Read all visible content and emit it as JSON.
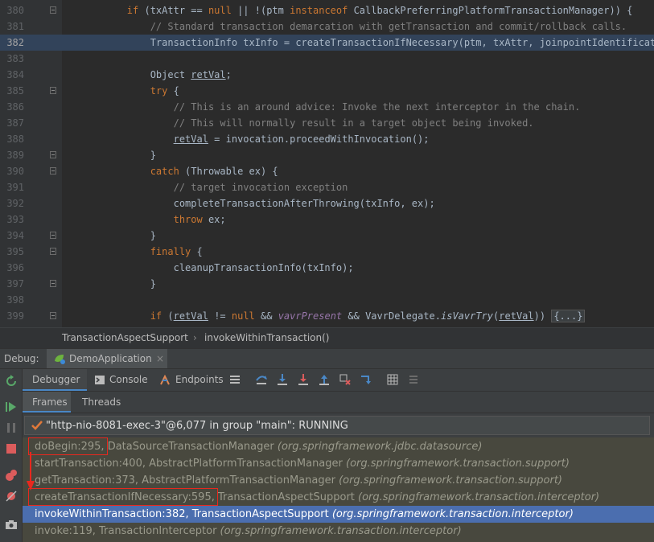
{
  "editor": {
    "lines": [
      {
        "n": "380",
        "fold": true,
        "indent": "        ",
        "parts": [
          [
            "kw",
            "if"
          ],
          [
            "p",
            " (txAttr == "
          ],
          [
            "kw",
            "null"
          ],
          [
            "p",
            " || !(ptm "
          ],
          [
            "kw",
            "instanceof"
          ],
          [
            "p",
            " CallbackPreferringPlatformTransactionManager)) {"
          ]
        ]
      },
      {
        "n": "381",
        "indent": "            ",
        "parts": [
          [
            "cm",
            "// Standard transaction demarcation with getTransaction and commit/rollback calls."
          ]
        ]
      },
      {
        "n": "382",
        "highlight": true,
        "indent": "            ",
        "parts": [
          [
            "p",
            "TransactionInfo txInfo = createTransactionIfNecessary(ptm, txAttr, joinpointIdentification);"
          ]
        ]
      },
      {
        "n": "383",
        "indent": "",
        "parts": []
      },
      {
        "n": "384",
        "indent": "            ",
        "parts": [
          [
            "p",
            "Object "
          ],
          [
            "ul",
            "retVal"
          ],
          [
            "p",
            ";"
          ]
        ]
      },
      {
        "n": "385",
        "fold": true,
        "indent": "            ",
        "parts": [
          [
            "kw",
            "try"
          ],
          [
            "p",
            " {"
          ]
        ]
      },
      {
        "n": "386",
        "indent": "                ",
        "parts": [
          [
            "cm",
            "// This is an around advice: Invoke the next interceptor in the chain."
          ]
        ]
      },
      {
        "n": "387",
        "indent": "                ",
        "parts": [
          [
            "cm",
            "// This will normally result in a target object being invoked."
          ]
        ]
      },
      {
        "n": "388",
        "indent": "                ",
        "parts": [
          [
            "ul",
            "retVal"
          ],
          [
            "p",
            " = invocation.proceedWithInvocation();"
          ]
        ]
      },
      {
        "n": "389",
        "fold": true,
        "indent": "            ",
        "parts": [
          [
            "p",
            "}"
          ]
        ]
      },
      {
        "n": "390",
        "fold": true,
        "indent": "            ",
        "parts": [
          [
            "kw",
            "catch"
          ],
          [
            "p",
            " (Throwable ex) {"
          ]
        ]
      },
      {
        "n": "391",
        "indent": "                ",
        "parts": [
          [
            "cm",
            "// target invocation exception"
          ]
        ]
      },
      {
        "n": "392",
        "indent": "                ",
        "parts": [
          [
            "p",
            "completeTransactionAfterThrowing(txInfo, ex);"
          ]
        ]
      },
      {
        "n": "393",
        "indent": "                ",
        "parts": [
          [
            "kw",
            "throw"
          ],
          [
            "p",
            " ex;"
          ]
        ]
      },
      {
        "n": "394",
        "fold": true,
        "indent": "            ",
        "parts": [
          [
            "p",
            "}"
          ]
        ]
      },
      {
        "n": "395",
        "fold": true,
        "indent": "            ",
        "parts": [
          [
            "kw",
            "finally"
          ],
          [
            "p",
            " {"
          ]
        ]
      },
      {
        "n": "396",
        "indent": "                ",
        "parts": [
          [
            "p",
            "cleanupTransactionInfo(txInfo);"
          ]
        ]
      },
      {
        "n": "397",
        "fold": true,
        "indent": "            ",
        "parts": [
          [
            "p",
            "}"
          ]
        ]
      },
      {
        "n": "398",
        "indent": "",
        "parts": []
      },
      {
        "n": "399",
        "fold": true,
        "indent": "            ",
        "parts": [
          [
            "kw",
            "if"
          ],
          [
            "p",
            " ("
          ],
          [
            "ul",
            "retVal"
          ],
          [
            "p",
            " != "
          ],
          [
            "kw",
            "null"
          ],
          [
            "p",
            " && "
          ],
          [
            "it",
            "vavrPresent"
          ],
          [
            "p",
            " && VavrDelegate."
          ],
          [
            "fn",
            "isVavrTry"
          ],
          [
            "p",
            "("
          ],
          [
            "ul",
            "retVal"
          ],
          [
            "p",
            ")) "
          ],
          [
            "fold",
            "{...}"
          ]
        ]
      }
    ]
  },
  "breadcrumb": {
    "class": "TransactionAspectSupport",
    "separator": "›",
    "method": "invokeWithinTransaction()"
  },
  "debug": {
    "label": "Debug:",
    "session": "DemoApplication",
    "close": "×"
  },
  "debugger_tabs": {
    "debugger": "Debugger",
    "console": "Console",
    "endpoints": "Endpoints"
  },
  "subtabs": {
    "frames": "Frames",
    "threads": "Threads"
  },
  "thread": {
    "text": "\"http-nio-8081-exec-3\"@6,077 in group \"main\": RUNNING"
  },
  "frames": [
    {
      "method": "doBegin:295,",
      "cls": " DataSourceTransactionManager ",
      "pkg": "(org.springframework.jdbc.datasource)"
    },
    {
      "method": "startTransaction:400,",
      "cls": " AbstractPlatformTransactionManager ",
      "pkg": "(org.springframework.transaction.support)"
    },
    {
      "method": "getTransaction:373,",
      "cls": " AbstractPlatformTransactionManager ",
      "pkg": "(org.springframework.transaction.support)"
    },
    {
      "method": "createTransactionIfNecessary:595,",
      "cls": " TransactionAspectSupport ",
      "pkg": "(org.springframework.transaction.interceptor)"
    },
    {
      "method": "invokeWithinTransaction:382,",
      "cls": " TransactionAspectSupport ",
      "pkg": "(org.springframework.transaction.interceptor)",
      "selected": true
    },
    {
      "method": "invoke:119,",
      "cls": " TransactionInterceptor ",
      "pkg": "(org.springframework.transaction.interceptor)"
    }
  ],
  "colors": {
    "keyword": "#cc7832",
    "comment": "#808080",
    "selection": "#4b6eaf",
    "annotation": "#e8281e"
  }
}
